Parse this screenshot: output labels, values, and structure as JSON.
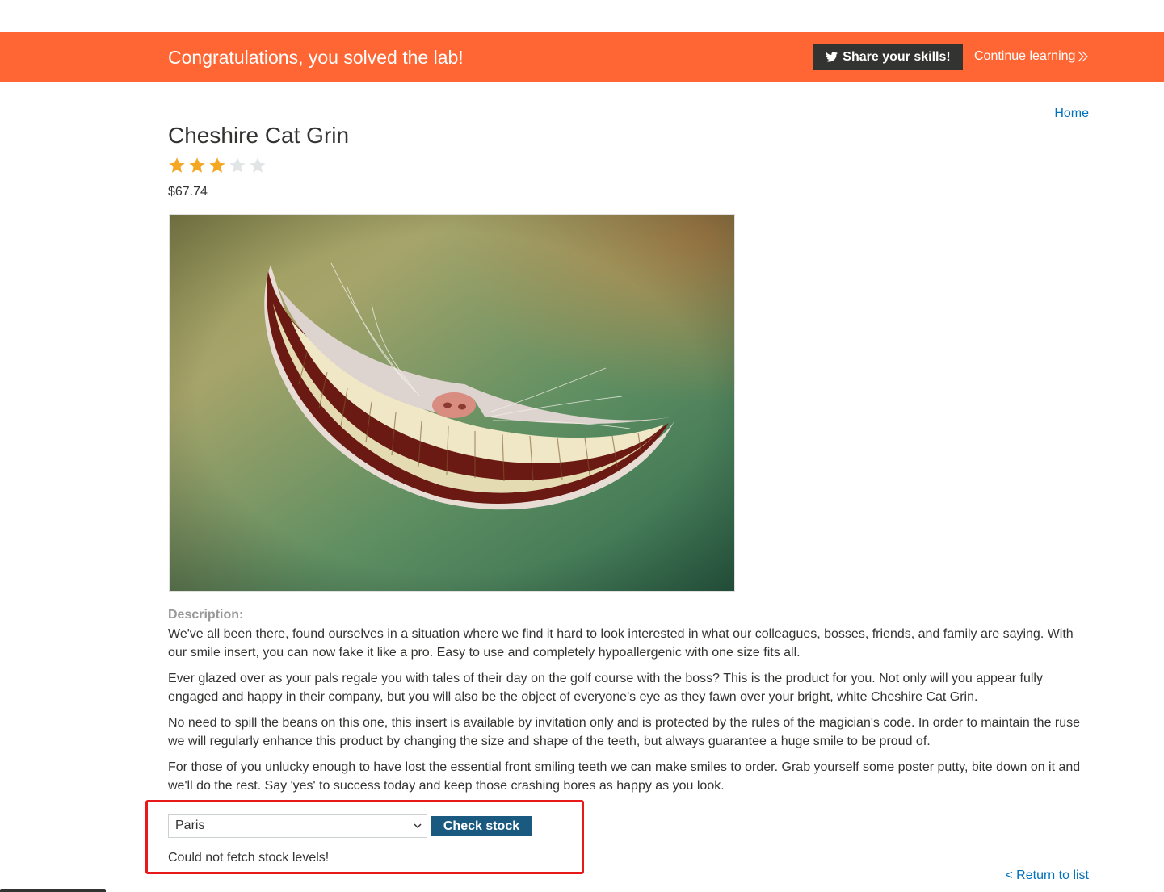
{
  "banner": {
    "title": "Congratulations, you solved the lab!",
    "share_label": "Share your skills!",
    "continue_label": "Continue learning",
    "color": "#ff6633"
  },
  "nav": {
    "home_label": "Home",
    "return_label": "< Return to list"
  },
  "product": {
    "title": "Cheshire Cat Grin",
    "rating": 3,
    "rating_max": 5,
    "price": "$67.74",
    "description_label": "Description:",
    "description": [
      "We've all been there, found ourselves in a situation where we find it hard to look interested in what our colleagues, bosses, friends, and family are saying. With our smile insert, you can now fake it like a pro. Easy to use and completely hypoallergenic with one size fits all.",
      "Ever glazed over as your pals regale you with tales of their day on the golf course with the boss? This is the product for you. Not only will you appear fully engaged and happy in their company, but you will also be the object of everyone's eye as they fawn over your bright, white Cheshire Cat Grin.",
      "No need to spill the beans on this one, this insert is available by invitation only and is protected by the rules of the magician's code. In order to maintain the ruse we will regularly enhance this product by changing the size and shape of the teeth, but always guarantee a huge smile to be proud of.",
      "For those of you unlucky enough to have lost the essential front smiling teeth we can make smiles to order. Grab yourself some poster putty, bite down on it and we'll do the rest. Say 'yes' to success today and keep those crashing bores as happy as you look."
    ]
  },
  "stock": {
    "selected_store": "Paris",
    "button_label": "Check stock",
    "message": "Could not fetch stock levels!"
  },
  "colors": {
    "link": "#0071bc",
    "button": "#1a5a80",
    "highlight": "#e8191b",
    "star_filled": "#f5a623",
    "star_empty": "#e2e5e6"
  }
}
